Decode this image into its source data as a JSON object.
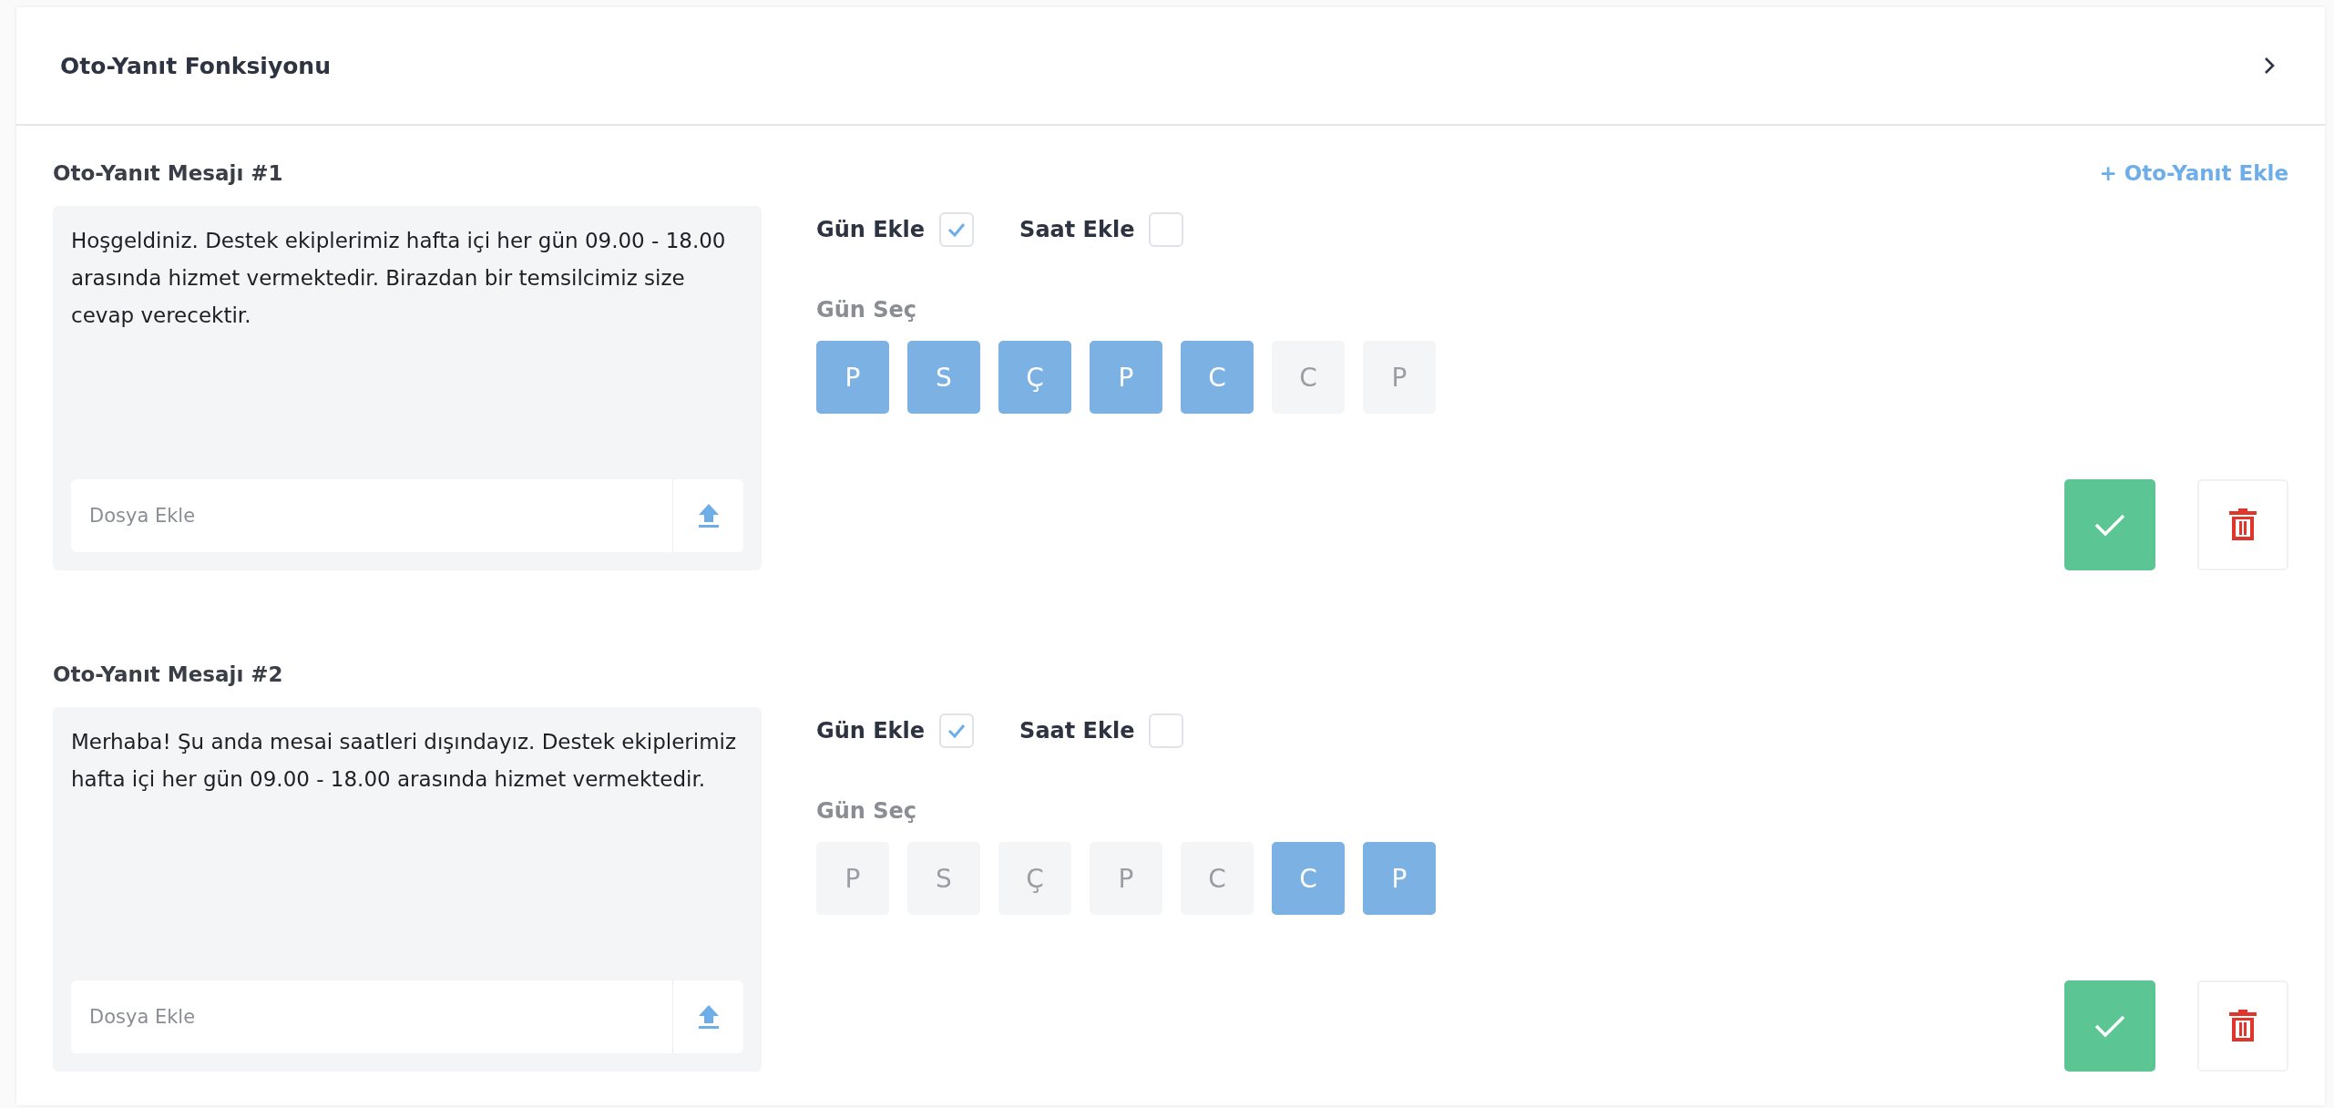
{
  "panel": {
    "title": "Oto-Yanıt Fonksiyonu",
    "expanded": false
  },
  "add_link": "+ Oto-Yanıt Ekle",
  "messages": [
    {
      "label": "Oto-Yanıt Mesajı #1",
      "text": "Hoşgeldiniz. Destek ekiplerimiz hafta içi her gün 09.00 - 18.00 arasında hizmet vermektedir. Birazdan bir temsilcimiz size cevap verecektir.",
      "file_placeholder": "Dosya Ekle",
      "add_day": {
        "label": "Gün Ekle",
        "checked": true
      },
      "add_time": {
        "label": "Saat Ekle",
        "checked": false
      },
      "day_select_label": "Gün Seç",
      "days": [
        {
          "label": "P",
          "selected": true
        },
        {
          "label": "S",
          "selected": true
        },
        {
          "label": "Ç",
          "selected": true
        },
        {
          "label": "P",
          "selected": true
        },
        {
          "label": "C",
          "selected": true
        },
        {
          "label": "C",
          "selected": false
        },
        {
          "label": "P",
          "selected": false
        }
      ]
    },
    {
      "label": "Oto-Yanıt Mesajı #2",
      "text": "Merhaba! Şu anda mesai saatleri dışındayız. Destek ekiplerimiz hafta içi her gün 09.00 - 18.00 arasında hizmet vermektedir.",
      "file_placeholder": "Dosya Ekle",
      "add_day": {
        "label": "Gün Ekle",
        "checked": true
      },
      "add_time": {
        "label": "Saat Ekle",
        "checked": false
      },
      "day_select_label": "Gün Seç",
      "days": [
        {
          "label": "P",
          "selected": false
        },
        {
          "label": "S",
          "selected": false
        },
        {
          "label": "Ç",
          "selected": false
        },
        {
          "label": "P",
          "selected": false
        },
        {
          "label": "C",
          "selected": false
        },
        {
          "label": "C",
          "selected": true
        },
        {
          "label": "P",
          "selected": true
        }
      ]
    }
  ]
}
